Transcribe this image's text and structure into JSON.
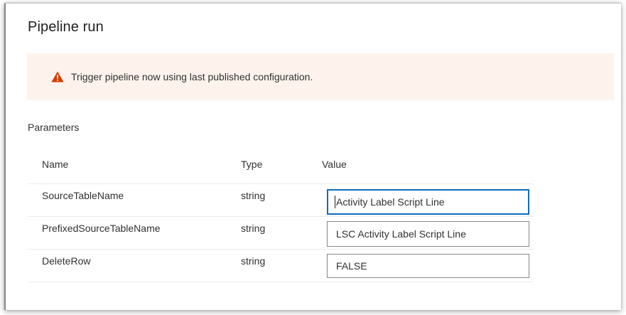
{
  "dialog": {
    "title": "Pipeline run"
  },
  "banner": {
    "icon": "warning-icon",
    "icon_color": "#d83b01",
    "text": "Trigger pipeline now using last published configuration."
  },
  "parameters": {
    "label": "Parameters",
    "columns": {
      "name": "Name",
      "type": "Type",
      "value": "Value"
    },
    "rows": [
      {
        "name": "SourceTableName",
        "type": "string",
        "value": "Activity Label Script Line",
        "focused": true
      },
      {
        "name": "PrefixedSourceTableName",
        "type": "string",
        "value": "LSC Activity Label Script Line",
        "focused": false
      },
      {
        "name": "DeleteRow",
        "type": "string",
        "value": "FALSE",
        "focused": false
      }
    ]
  },
  "colors": {
    "banner_bg": "#fdf3ec",
    "focus_border": "#0f6cbd"
  }
}
